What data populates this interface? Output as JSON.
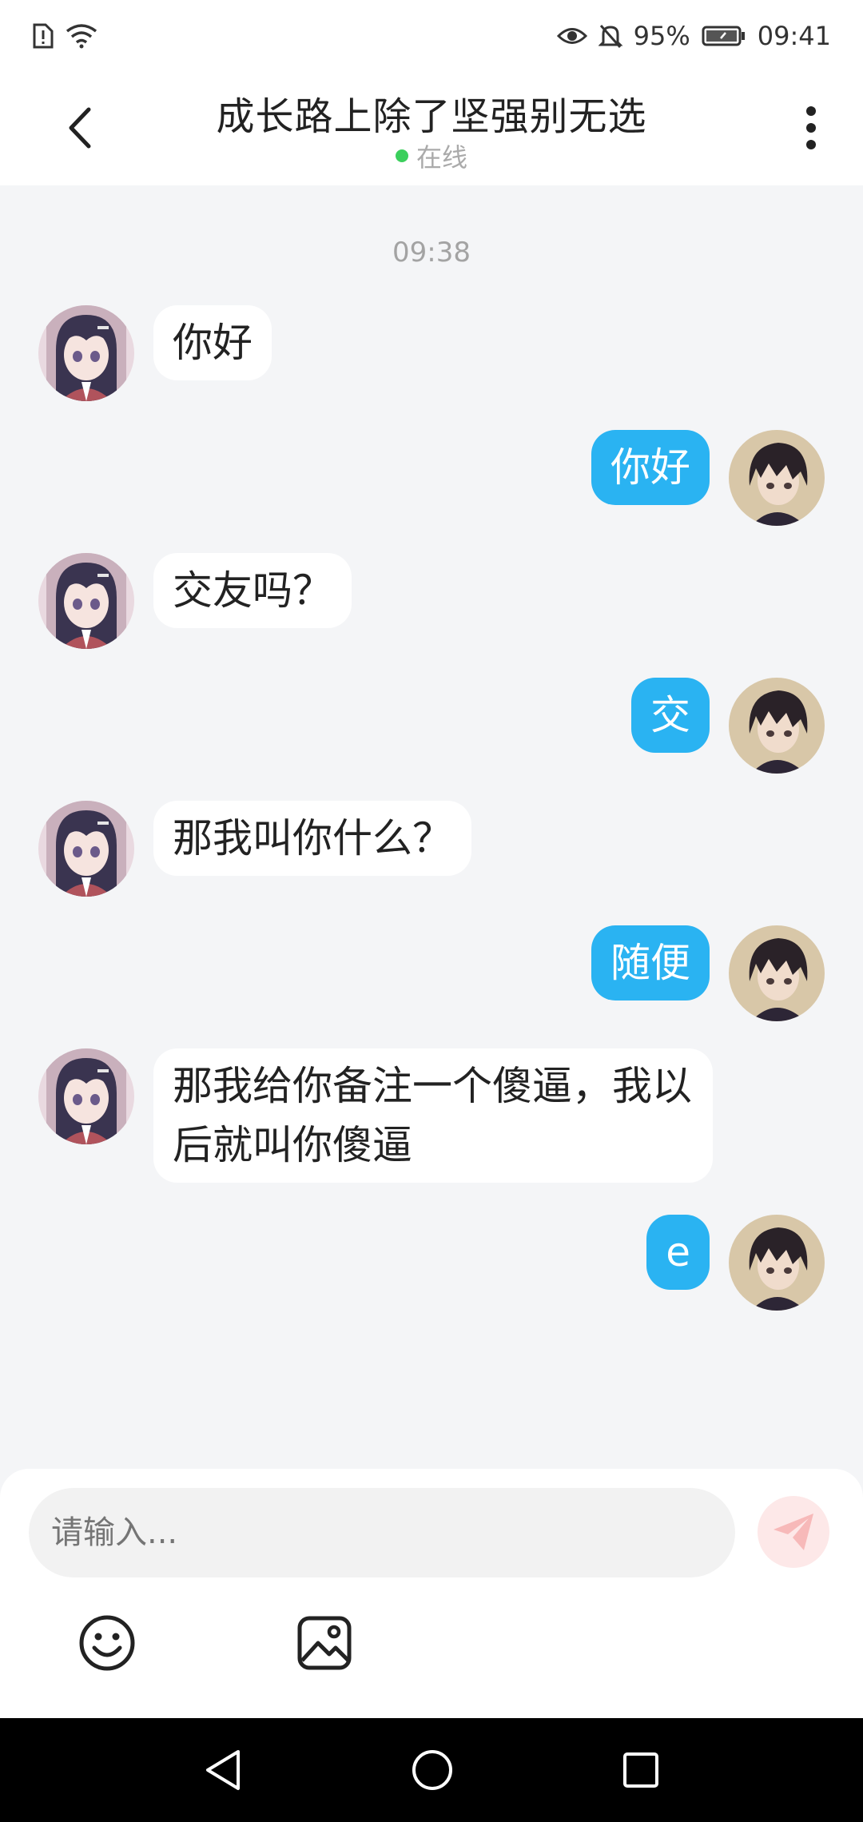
{
  "status_bar": {
    "battery": "95%",
    "time": "09:41"
  },
  "header": {
    "title": "成长路上除了坚强别无选",
    "status": "在线"
  },
  "chat": {
    "timestamp": "09:38",
    "messages": [
      {
        "side": "left",
        "text": "你好"
      },
      {
        "side": "right",
        "text": "你好"
      },
      {
        "side": "left",
        "text": "交友吗？"
      },
      {
        "side": "right",
        "text": "交"
      },
      {
        "side": "left",
        "text": "那我叫你什么？"
      },
      {
        "side": "right",
        "text": "随便"
      },
      {
        "side": "left",
        "text": "那我给你备注一个傻逼，我以后就叫你傻逼"
      },
      {
        "side": "right",
        "text": "e"
      }
    ]
  },
  "input": {
    "placeholder": "请输入..."
  },
  "colors": {
    "accent": "#2ab3f2",
    "online": "#3bcf5c",
    "background": "#f4f5f7",
    "send_button": "#fde8e8"
  },
  "icons": {
    "back": "chevron-left-icon",
    "more": "more-vertical-icon",
    "send": "send-icon",
    "emoji": "emoji-icon",
    "image": "image-icon"
  }
}
